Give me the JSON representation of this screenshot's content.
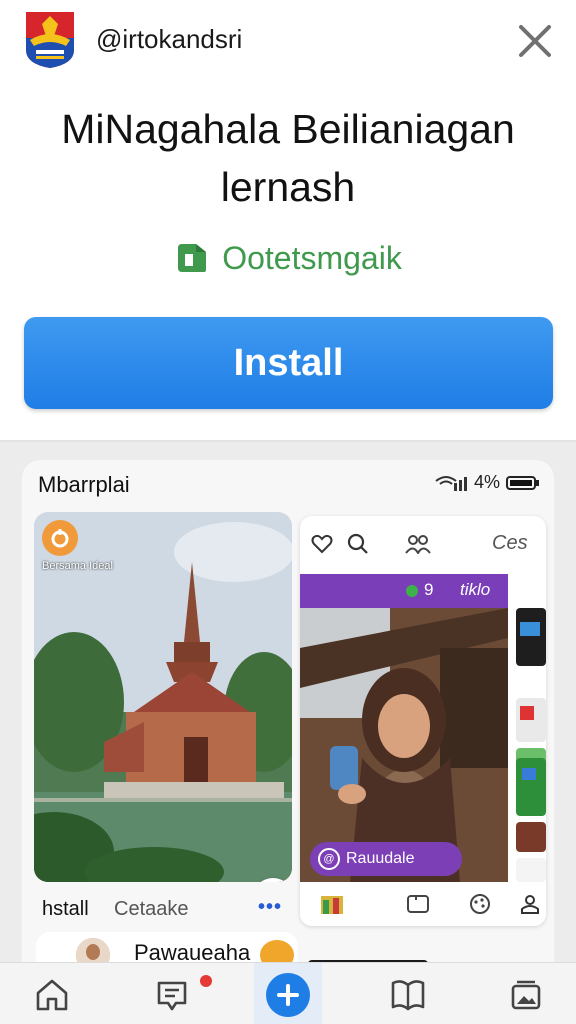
{
  "header": {
    "username": "@irtokandsri"
  },
  "title": "MiNagahala Beilianiagan lernash",
  "developer": {
    "name": "Ootetsmgaik"
  },
  "install_button": "Install",
  "preview": {
    "phone_title": "Mbarrplai",
    "battery": "4%",
    "card_badge_text": "Bersama Ideal",
    "install_label": "hstall",
    "catalog_label": "Cetaake",
    "more_label": "•••",
    "list_name": "Pawaueaha",
    "inner_app": {
      "top_label": "Ces",
      "count": "9",
      "count_label": "tiklo",
      "photo_label": "Rauudale"
    }
  },
  "colors": {
    "accent": "#1f7de6",
    "developer": "#3f9a4d",
    "purple": "#7a3fb8"
  },
  "nav": {
    "items": [
      "home-icon",
      "feed-icon",
      "add-icon",
      "book-icon",
      "gallery-icon"
    ]
  }
}
